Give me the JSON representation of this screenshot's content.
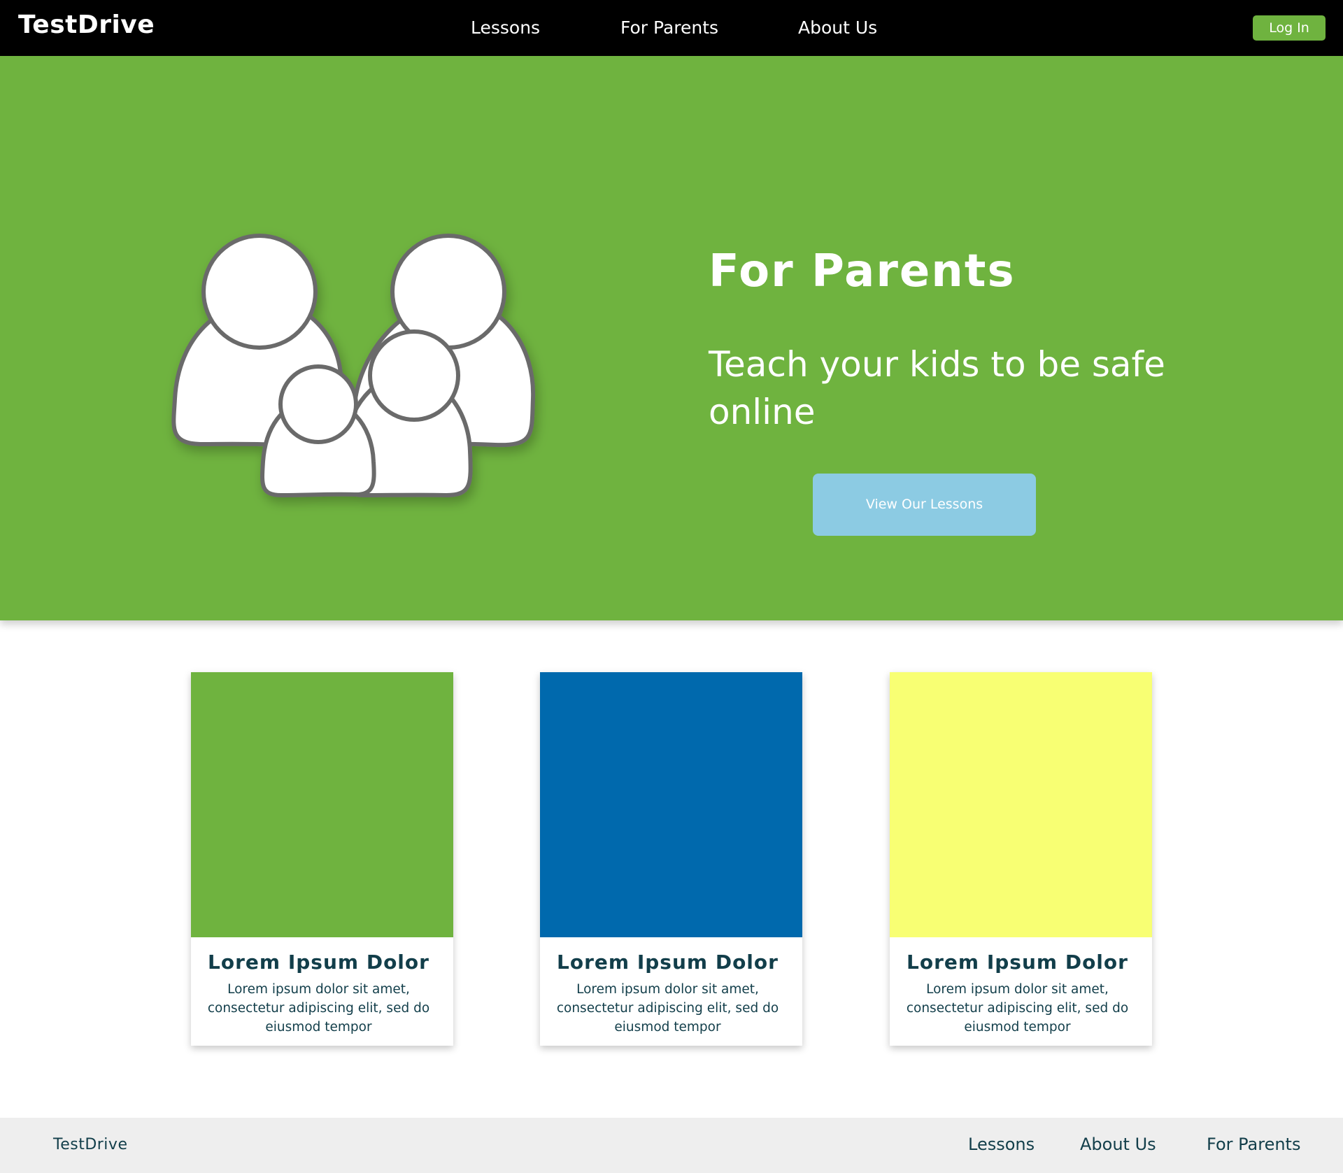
{
  "header": {
    "brand": "TestDrive",
    "nav": [
      "Lessons",
      "For Parents",
      "About Us"
    ],
    "login_label": "Log In"
  },
  "hero": {
    "title": "For Parents",
    "subtitle": "Teach your kids to be safe online",
    "cta_label": "View Our Lessons",
    "illustration_icon": "family-icon"
  },
  "cards": [
    {
      "title": "Lorem Ipsum Dolor",
      "text": "Lorem ipsum dolor sit amet, consectetur adipiscing elit, sed do eiusmod tempor",
      "color": "#6fb33f"
    },
    {
      "title": "Lorem Ipsum Dolor",
      "text": "Lorem ipsum dolor sit amet, consectetur adipiscing elit, sed do eiusmod tempor",
      "color": "#0069ad"
    },
    {
      "title": "Lorem Ipsum Dolor",
      "text": "Lorem ipsum dolor sit amet, consectetur adipiscing elit, sed do eiusmod tempor",
      "color": "#f8ff73"
    }
  ],
  "footer": {
    "brand": "TestDrive",
    "nav": [
      "Lessons",
      "About Us",
      "For Parents"
    ]
  },
  "colors": {
    "nav_bg": "#000000",
    "accent_green": "#6fb33f",
    "cta_blue": "#8ccbe3",
    "text_dark": "#123e4a",
    "footer_bg": "#eeeeee"
  }
}
